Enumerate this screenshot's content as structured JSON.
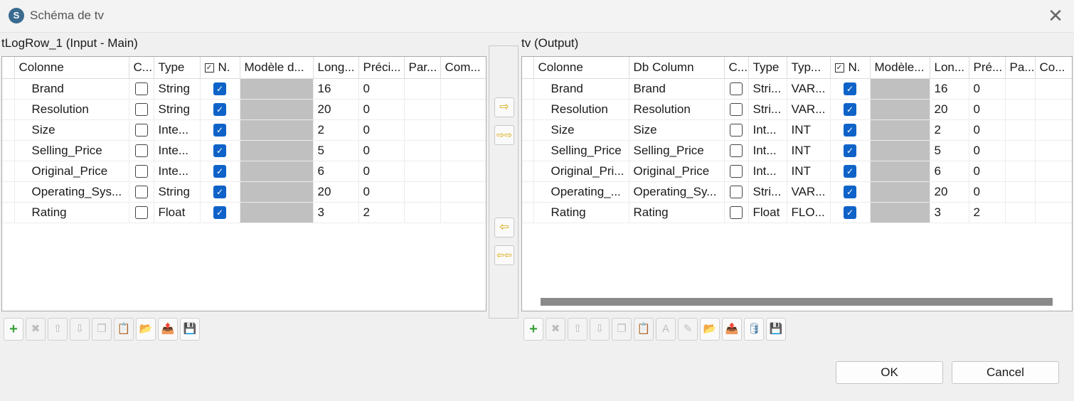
{
  "window": {
    "title": "Schéma de tv",
    "close_symbol": "✕"
  },
  "input": {
    "label": "tLogRow_1 (Input - Main)",
    "headers": {
      "col": "Colonne",
      "key": "C...",
      "type": "Type",
      "nullable": "N.",
      "model": "Modèle d...",
      "length": "Long...",
      "precision": "Préci...",
      "pattern": "Par...",
      "comment": "Com..."
    },
    "rows": [
      {
        "col": "Brand",
        "type": "String",
        "len": "16",
        "prec": "0"
      },
      {
        "col": "Resolution",
        "type": "String",
        "len": "20",
        "prec": "0"
      },
      {
        "col": "Size",
        "type": "Inte...",
        "len": "2",
        "prec": "0"
      },
      {
        "col": "Selling_Price",
        "type": "Inte...",
        "len": "5",
        "prec": "0"
      },
      {
        "col": "Original_Price",
        "type": "Inte...",
        "len": "6",
        "prec": "0"
      },
      {
        "col": "Operating_Sys...",
        "type": "String",
        "len": "20",
        "prec": "0"
      },
      {
        "col": "Rating",
        "type": "Float",
        "len": "3",
        "prec": "2"
      }
    ]
  },
  "output": {
    "label": "tv (Output)",
    "headers": {
      "col": "Colonne",
      "db": "Db Column",
      "key": "C...",
      "type": "Type",
      "dbtype": "Typ...",
      "nullable": "N.",
      "model": "Modèle...",
      "length": "Lon...",
      "precision": "Pré...",
      "pattern": "Pa...",
      "comment": "Co..."
    },
    "rows": [
      {
        "col": "Brand",
        "db": "Brand",
        "type": "Stri...",
        "dbtype": "VAR...",
        "len": "16",
        "prec": "0"
      },
      {
        "col": "Resolution",
        "db": "Resolution",
        "type": "Stri...",
        "dbtype": "VAR...",
        "len": "20",
        "prec": "0"
      },
      {
        "col": "Size",
        "db": "Size",
        "type": "Int...",
        "dbtype": "INT",
        "len": "2",
        "prec": "0"
      },
      {
        "col": "Selling_Price",
        "db": "Selling_Price",
        "type": "Int...",
        "dbtype": "INT",
        "len": "5",
        "prec": "0"
      },
      {
        "col": "Original_Pri...",
        "db": "Original_Price",
        "type": "Int...",
        "dbtype": "INT",
        "len": "6",
        "prec": "0"
      },
      {
        "col": "Operating_...",
        "db": "Operating_Sy...",
        "type": "Stri...",
        "dbtype": "VAR...",
        "len": "20",
        "prec": "0"
      },
      {
        "col": "Rating",
        "db": "Rating",
        "type": "Float",
        "dbtype": "FLO...",
        "len": "3",
        "prec": "2"
      }
    ]
  },
  "transfer": {
    "copy_selected": "⇨",
    "copy_all": "⇨⇨",
    "back_selected": "⇦",
    "back_all": "⇦⇦"
  },
  "toolbar_icons": {
    "add": "+",
    "remove": "✖",
    "up": "⇧",
    "down": "⇩",
    "copy": "❐",
    "paste": "📋",
    "import": "📂",
    "export": "📤",
    "text": "A",
    "edit": "✎",
    "db": "🛢",
    "save": "💾"
  },
  "buttons": {
    "ok": "OK",
    "cancel": "Cancel"
  }
}
